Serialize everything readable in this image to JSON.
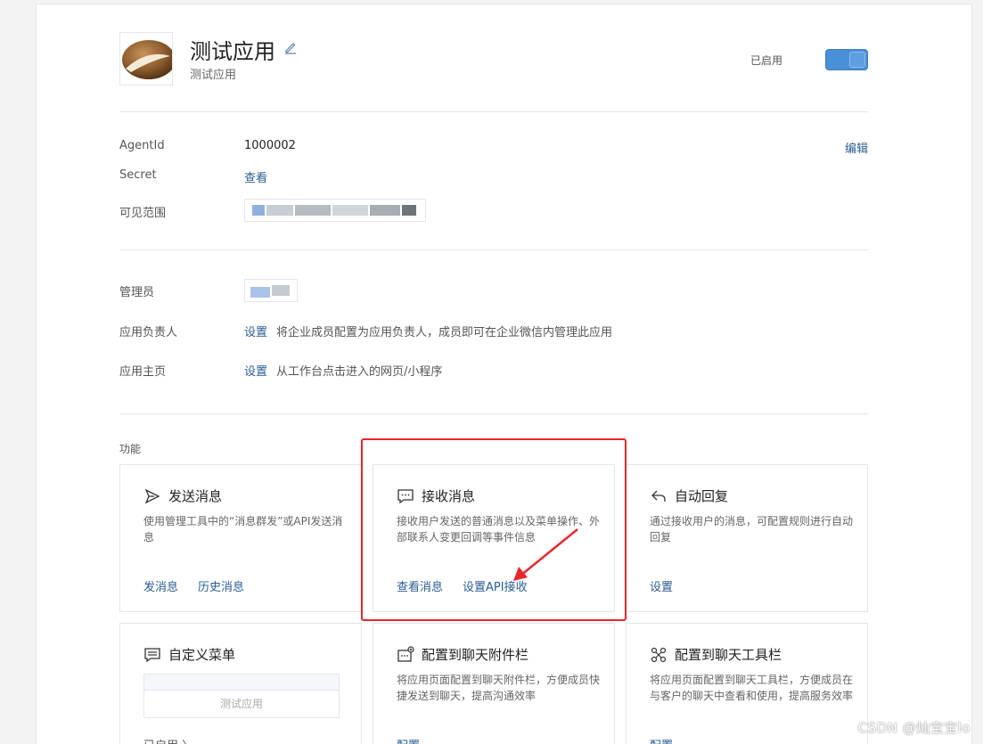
{
  "header": {
    "app_name": "测试应用",
    "app_subtitle": "测试应用",
    "status_label": "已启用"
  },
  "info": {
    "agentid_label": "AgentId",
    "agentid_value": "1000002",
    "edit_label": "编辑",
    "secret_label": "Secret",
    "secret_action": "查看",
    "scope_label": "可见范围"
  },
  "settings": {
    "admin_label": "管理员",
    "owner_label": "应用负责人",
    "owner_action": "设置",
    "owner_desc": "将企业成员配置为应用负责人，成员即可在企业微信内管理此应用",
    "homepage_label": "应用主页",
    "homepage_action": "设置",
    "homepage_desc": "从工作台点击进入的网页/小程序"
  },
  "features": {
    "section_title": "功能",
    "cards": [
      {
        "title": "发送消息",
        "icon": "send-icon",
        "desc": "使用管理工具中的“消息群发”或API发送消息",
        "links": [
          "发消息",
          "历史消息"
        ]
      },
      {
        "title": "接收消息",
        "icon": "chat-bubble-icon",
        "desc": "接收用户发送的普通消息以及菜单操作、外部联系人变更回调等事件信息",
        "links": [
          "查看消息",
          "设置API接收"
        ]
      },
      {
        "title": "自动回复",
        "icon": "reply-icon",
        "desc": "通过接收用户的消息，可配置规则进行自动回复",
        "links": [
          "设置"
        ]
      },
      {
        "title": "自定义菜单",
        "icon": "menu-list-icon",
        "preview_label": "测试应用",
        "links": [
          "已启用 〉"
        ]
      },
      {
        "title": "配置到聊天附件栏",
        "icon": "attachment-bar-icon",
        "desc": "将应用页面配置到聊天附件栏，方便成员快捷发送到聊天，提高沟通效率",
        "links": [
          "配置"
        ]
      },
      {
        "title": "配置到聊天工具栏",
        "icon": "toolbar-icon",
        "desc": "将应用页面配置到聊天工具栏，方便成员在与客户的聊天中查看和使用，提高服务效率",
        "links": [
          "配置"
        ]
      }
    ]
  },
  "colors": {
    "link": "#2a5d94",
    "toggle_on": "#4a90d9",
    "highlight": "#e8262d"
  },
  "watermark": "CSDN @灿宝宝lo"
}
